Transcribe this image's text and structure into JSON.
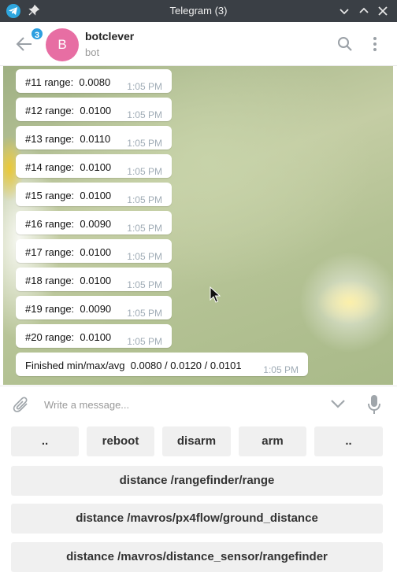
{
  "window": {
    "title": "Telegram (3)"
  },
  "header": {
    "unread_count": "3",
    "avatar_initial": "B",
    "chat_name": "botclever",
    "chat_status": "bot"
  },
  "messages": [
    {
      "text": "#11 range:  0.0080",
      "time": "1:05 PM"
    },
    {
      "text": "#12 range:  0.0100",
      "time": "1:05 PM"
    },
    {
      "text": "#13 range:  0.0110",
      "time": "1:05 PM"
    },
    {
      "text": "#14 range:  0.0100",
      "time": "1:05 PM"
    },
    {
      "text": "#15 range:  0.0100",
      "time": "1:05 PM"
    },
    {
      "text": "#16 range:  0.0090",
      "time": "1:05 PM"
    },
    {
      "text": "#17 range:  0.0100",
      "time": "1:05 PM"
    },
    {
      "text": "#18 range:  0.0100",
      "time": "1:05 PM"
    },
    {
      "text": "#19 range:  0.0090",
      "time": "1:05 PM"
    },
    {
      "text": "#20 range:  0.0100",
      "time": "1:05 PM"
    },
    {
      "text": "Finished min/max/avg  0.0080 / 0.0120 / 0.0101",
      "time": "1:05 PM"
    }
  ],
  "composer": {
    "placeholder": "Write a message..."
  },
  "keyboard": {
    "row1": [
      "..",
      "reboot",
      "disarm",
      "arm",
      ".."
    ],
    "row2": "distance /rangefinder/range",
    "row3": "distance /mavros/px4flow/ground_distance",
    "row4": "distance /mavros/distance_sensor/rangefinder"
  },
  "colors": {
    "titlebar": "#3a3f45",
    "accent": "#2d9fe0",
    "avatar": "#e76ea3",
    "keyboard_button": "#f0f0f0"
  }
}
